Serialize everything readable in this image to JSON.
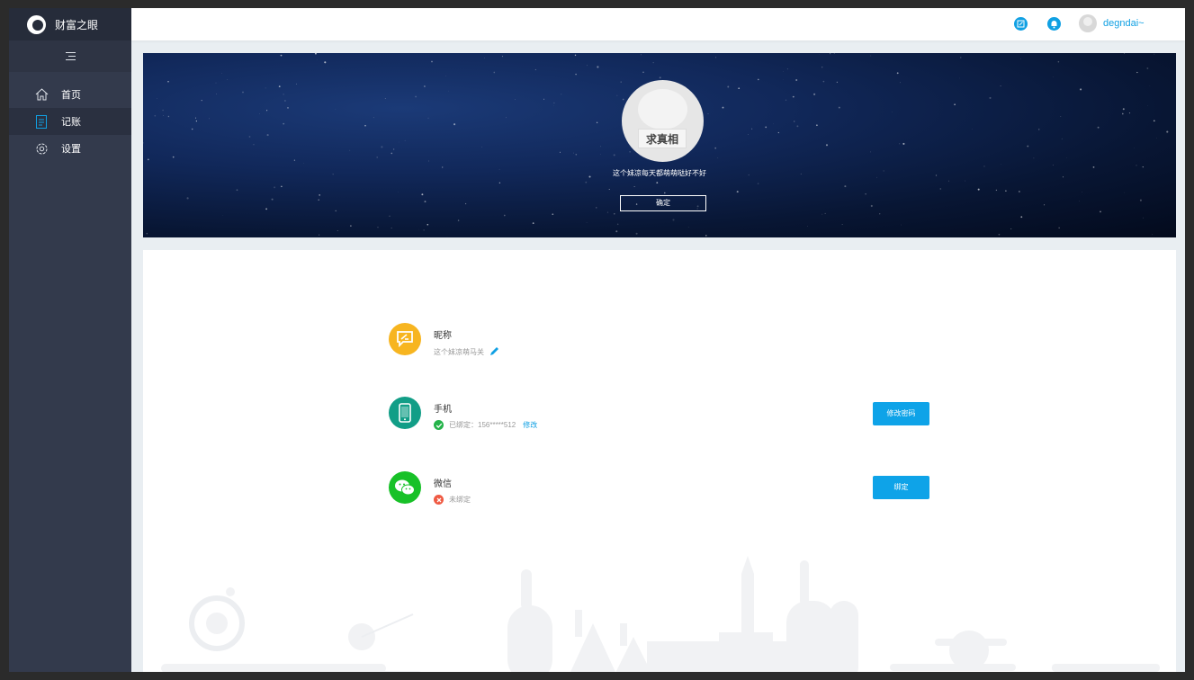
{
  "brand": {
    "name": "财富之眼"
  },
  "sidebar": {
    "items": [
      {
        "label": "首页",
        "icon": "home-icon"
      },
      {
        "label": "记账",
        "icon": "ledger-icon",
        "active": true
      },
      {
        "label": "设置",
        "icon": "gear-icon"
      }
    ]
  },
  "header": {
    "username": "degndai~",
    "icons": [
      "edit-icon",
      "bell-icon",
      "user-avatar"
    ]
  },
  "banner": {
    "avatar_stamp": "求真相",
    "motto": "这个妹凉每天都萌萌哒好不好",
    "confirm_label": "确定"
  },
  "profile": {
    "nickname": {
      "label": "昵称",
      "value": "这个妹凉萌马关"
    },
    "phone": {
      "label": "手机",
      "status": "已绑定：156*****512",
      "action": "修改",
      "button": "修改密码"
    },
    "wechat": {
      "label": "微信",
      "status": "未绑定",
      "button": "绑定"
    }
  },
  "colors": {
    "accent": "#10a0e3",
    "sidebar": "#333a4c",
    "nickname_icon": "#f7b520",
    "phone_icon": "#129e87",
    "wechat_icon": "#18c128",
    "ok_status": "#25b34a",
    "fail_status": "#ef5a43"
  }
}
